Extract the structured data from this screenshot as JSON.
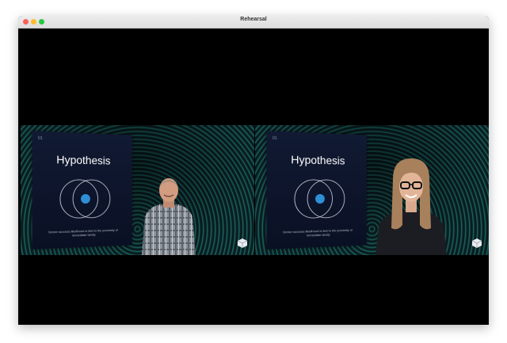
{
  "window": {
    "title": "Rehearsal"
  },
  "tiles": [
    {
      "slide": {
        "number": "01",
        "title": "Hypothesis",
        "caption": "Senior success likelihood is tied to the proximity of immediate family"
      },
      "participant": "man-presenter",
      "logo_icon": "cube-logo-icon"
    },
    {
      "slide": {
        "number": "01",
        "title": "Hypothesis",
        "caption": "Senior success likelihood is tied to the proximity of immediate family"
      },
      "participant": "woman-presenter",
      "logo_icon": "cube-logo-icon"
    }
  ],
  "colors": {
    "background": "#000000",
    "tile_stripes": "#1d7470",
    "slide_bg": "#111a33",
    "venn_fill": "#2f8fd6"
  }
}
